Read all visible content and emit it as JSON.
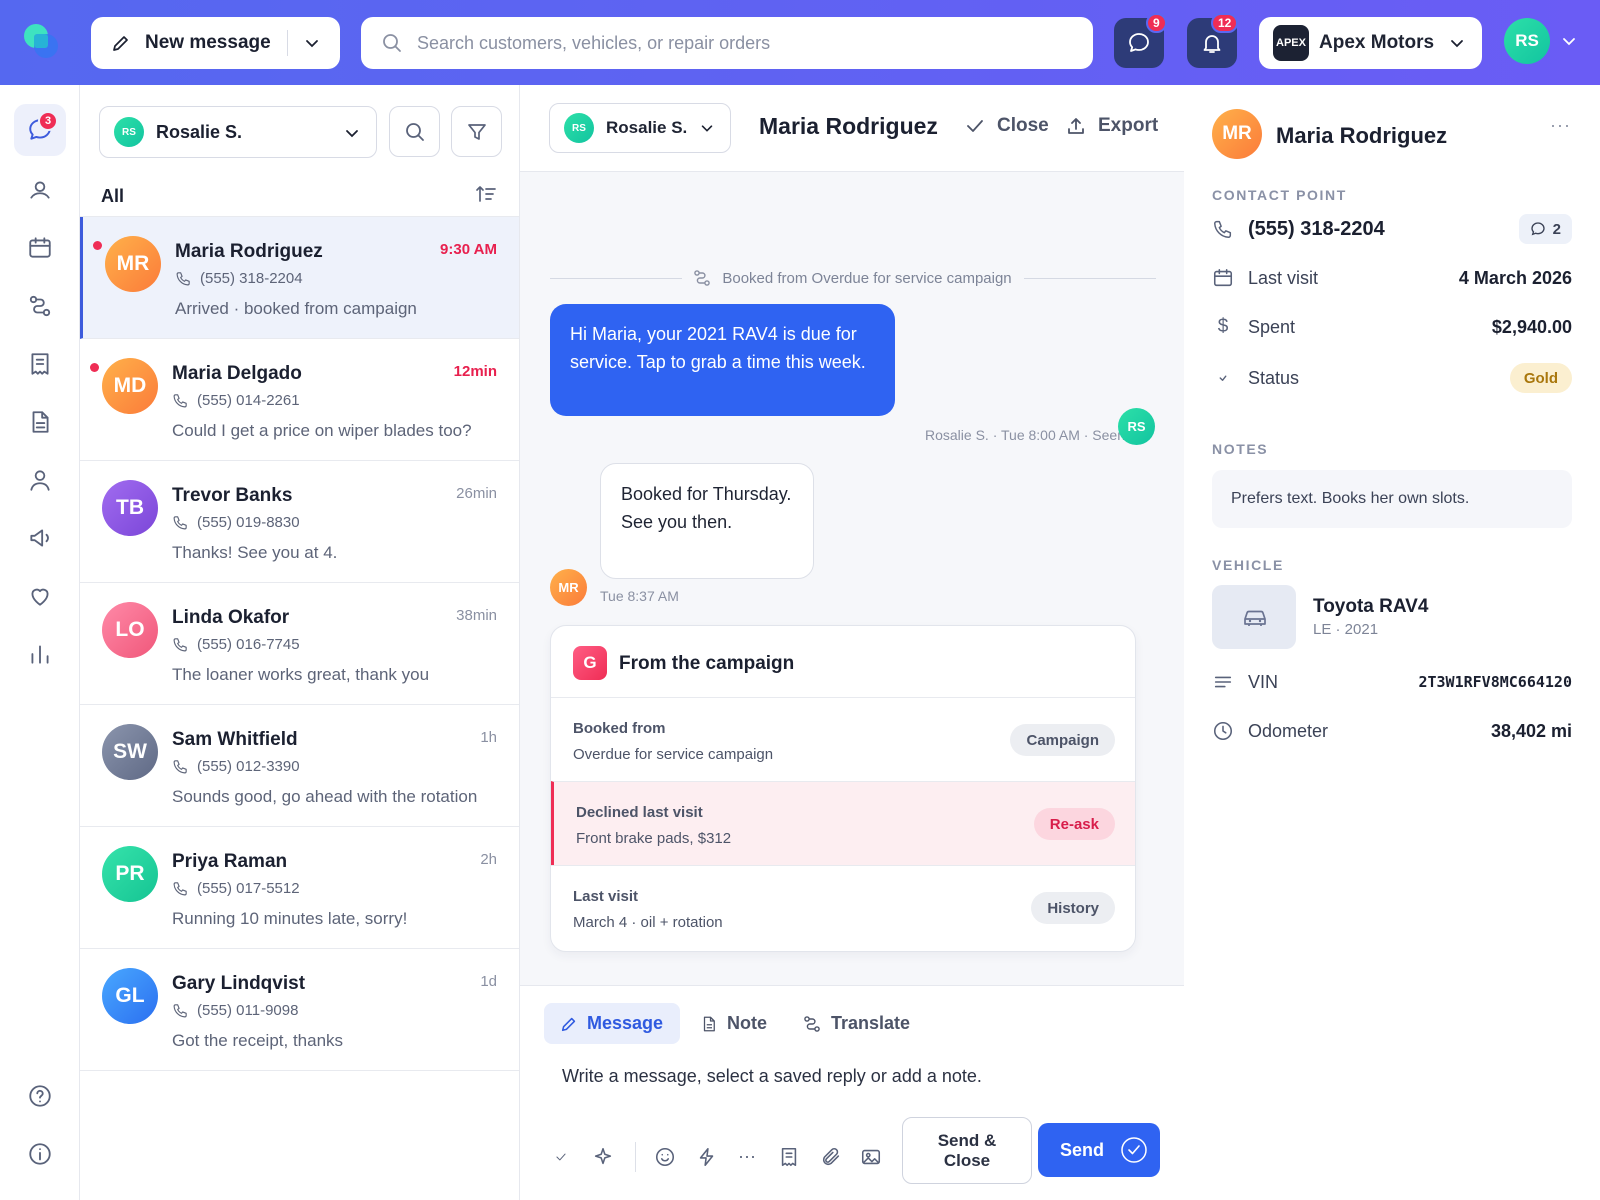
{
  "topbar": {
    "new_message_label": "New message",
    "search_placeholder": "Search customers, vehicles, or repair orders",
    "messages_badge": "9",
    "notifications_badge": "12",
    "shop_logo_text": "APEX",
    "shop_name": "Apex Motors",
    "user_initials": "RS",
    "colors": {
      "brand_gradient_start": "#5568f0",
      "brand_gradient_end": "#6a5cf5"
    }
  },
  "rail": {
    "inbox_badge": "3",
    "icons": [
      "chat-icon",
      "contacts-icon",
      "calendar-icon",
      "workflow-icon",
      "receipt-icon",
      "document-icon",
      "user-icon",
      "megaphone-icon",
      "heart-icon",
      "chart-icon",
      "help-icon",
      "info-icon"
    ]
  },
  "list": {
    "assignee_initials": "RS",
    "assignee_name": "Rosalie S.",
    "filter_label": "All",
    "conversations": [
      {
        "initials": "MR",
        "name": "Maria Rodriguez",
        "time": "9:30 AM",
        "phone": "(555) 318-2204",
        "preview": "Arrived · booked from campaign",
        "unread": true,
        "selected": true
      },
      {
        "initials": "MD",
        "name": "Maria Delgado",
        "time": "12min",
        "phone": "(555) 014-2261",
        "preview": "Could I get a price on wiper blades too?",
        "unread": true,
        "selected": false
      },
      {
        "initials": "TB",
        "name": "Trevor Banks",
        "time": "26min",
        "phone": "(555) 019-8830",
        "preview": "Thanks! See you at 4.",
        "unread": false,
        "selected": false
      },
      {
        "initials": "LO",
        "name": "Linda Okafor",
        "time": "38min",
        "phone": "(555) 016-7745",
        "preview": "The loaner works great, thank you",
        "unread": false,
        "selected": false
      },
      {
        "initials": "SW",
        "name": "Sam Whitfield",
        "time": "1h",
        "phone": "(555) 012-3390",
        "preview": "Sounds good, go ahead with the rotation",
        "unread": false,
        "selected": false
      },
      {
        "initials": "PR",
        "name": "Priya Raman",
        "time": "2h",
        "phone": "(555) 017-5512",
        "preview": "Running 10 minutes late, sorry!",
        "unread": false,
        "selected": false
      },
      {
        "initials": "GL",
        "name": "Gary Lindqvist",
        "time": "1d",
        "phone": "(555) 011-9098",
        "preview": "Got the receipt, thanks",
        "unread": false,
        "selected": false
      }
    ]
  },
  "chat": {
    "assignee_initials": "RS",
    "assignee_name": "Rosalie S.",
    "contact_name": "Maria Rodriguez",
    "close_label": "Close",
    "export_label": "Export",
    "system_event": "Booked from Overdue for service campaign",
    "outgoing_text": "Hi Maria, your 2021 RAV4 is due for service. Tap to grab a time this week.",
    "outgoing_meta": "Rosalie S. · Tue 8:00 AM · Seen",
    "outgoing_avatar": "RS",
    "incoming_text": "Booked for Thursday. See you then.",
    "incoming_meta": "Tue 8:37 AM",
    "incoming_avatar": "MR",
    "campaign": {
      "logo_letter": "G",
      "title": "From the campaign",
      "rows": [
        {
          "label": "Booked from",
          "detail": "Overdue for service campaign",
          "pill": "Campaign"
        },
        {
          "label": "Declined last visit",
          "detail": "Front brake pads, $312",
          "pill": "Re-ask"
        },
        {
          "label": "Last visit",
          "detail": "March 4 · oil + rotation",
          "pill": "History"
        }
      ]
    },
    "composer": {
      "tabs": [
        "Message",
        "Note",
        "Translate"
      ],
      "placeholder": "Write a message, select a saved reply or add a note.",
      "send_close_label": "Send & Close",
      "send_label": "Send",
      "accent": "#2f63f2"
    }
  },
  "details": {
    "initials": "MR",
    "name": "Maria Rodriguez",
    "contact_point_heading": "CONTACT POINT",
    "phone": "(555) 318-2204",
    "conversation_count": "2",
    "last_visit_label": "Last visit",
    "last_visit_value": "4 March 2026",
    "spent_label": "Spent",
    "spent_value": "$2,940.00",
    "status_label": "Status",
    "status_value": "Gold",
    "notes_heading": "NOTES",
    "notes_text": "Prefers text. Books her own slots.",
    "vehicle_heading": "VEHICLE",
    "vehicle_name": "Toyota RAV4",
    "vehicle_sub": "LE · 2021",
    "vin_label": "VIN",
    "vin_value": "2T3W1RFV8MC664120",
    "odometer_label": "Odometer",
    "odometer_value": "38,402 mi"
  }
}
